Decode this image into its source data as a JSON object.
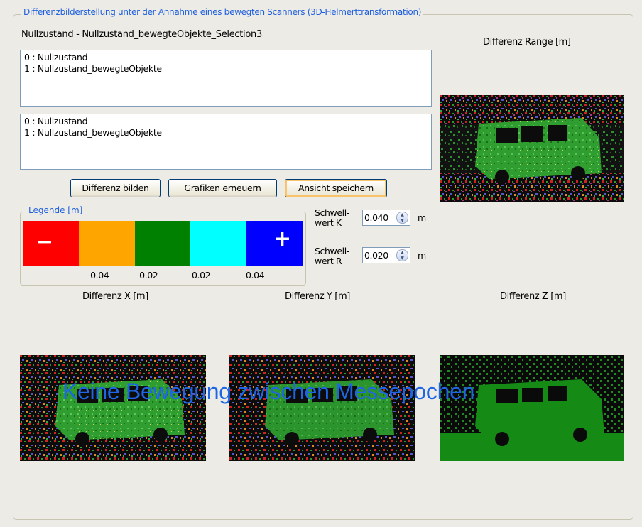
{
  "frame": {
    "title": "Differenzbilderstellung unter der Annahme eines bewegten Scanners (3D-Helmerttransformation)"
  },
  "selection_label": "Nullzustand - Nullzustand_bewegteObjekte_Selection3",
  "list_a": {
    "items": [
      "0 : Nullzustand",
      "1 : Nullzustand_bewegteObjekte"
    ]
  },
  "list_b": {
    "items": [
      "0 : Nullzustand",
      "1 : Nullzustand_bewegteObjekte"
    ]
  },
  "buttons": {
    "differenz": "Differenz bilden",
    "grafiken": "Grafiken erneuern",
    "ansicht": "Ansicht speichern"
  },
  "legend": {
    "title": "Legende [m]",
    "minus": "−",
    "plus": "+",
    "ticks": [
      "-0.04",
      "-0.02",
      "0.02",
      "0.04"
    ],
    "colors": [
      "#ff0000",
      "#ffa500",
      "#008000",
      "#00ffff",
      "#0000ff"
    ]
  },
  "threshold": {
    "k_label_1": "Schwell-",
    "k_label_2": "wert K",
    "k_value": "0.040",
    "r_label_1": "Schwell-",
    "r_label_2": "wert R",
    "r_value": "0.020",
    "unit": "m"
  },
  "panels": {
    "range_label": "Differenz Range [m]",
    "x_label": "Differenz X [m]",
    "y_label": "Differenz Y [m]",
    "z_label": "Differenz Z [m]"
  },
  "overlay": "Keine Bewegung zwischen Messepochen",
  "icons": {
    "spin_up": "spin-up-icon",
    "spin_down": "spin-down-icon"
  }
}
